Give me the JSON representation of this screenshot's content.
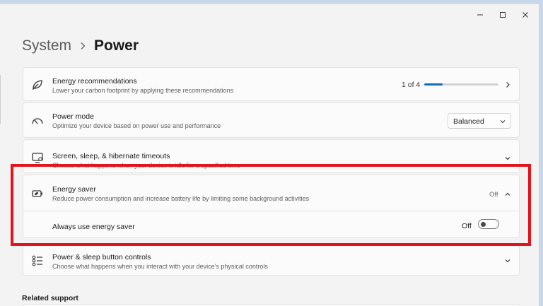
{
  "breadcrumb": {
    "parent": "System",
    "current": "Power"
  },
  "energy_recommendations": {
    "title": "Energy recommendations",
    "description": "Lower your carbon footprint by applying these recommendations",
    "progress_text": "1 of 4",
    "progress_fraction": 0.25
  },
  "power_mode": {
    "title": "Power mode",
    "description": "Optimize your device based on power use and performance",
    "selected": "Balanced"
  },
  "screen_sleep": {
    "title": "Screen, sleep, & hibernate timeouts",
    "description": "Choose what happens when your device is idle for a specified time"
  },
  "energy_saver": {
    "title": "Energy saver",
    "description": "Reduce power consumption and increase battery life by limiting some background activities",
    "status": "Off",
    "always_use_label": "Always use energy saver",
    "toggle_status": "Off",
    "toggle_on": false
  },
  "power_buttons": {
    "title": "Power & sleep button controls",
    "description": "Choose what happens when you interact with your device's physical controls"
  },
  "related_support": {
    "title": "Related support"
  },
  "colors": {
    "accent": "#0f6cbd",
    "highlight": "#e5141c"
  },
  "icons": {
    "leaf": "leaf-icon",
    "power_mode": "speedometer-icon",
    "screen": "monitor-sleep-icon",
    "battery": "battery-saver-icon",
    "buttons": "list-controls-icon"
  }
}
